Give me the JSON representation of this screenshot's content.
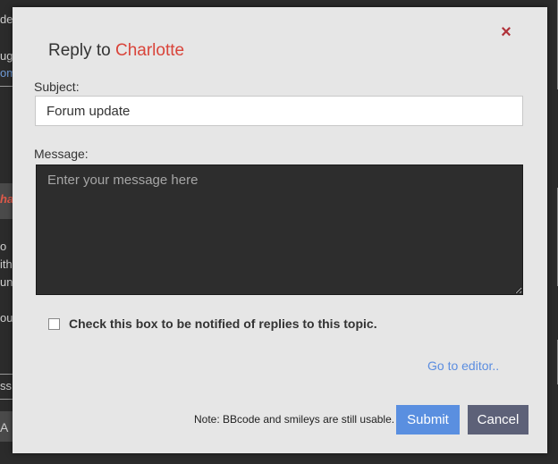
{
  "background_fragments": {
    "f1": "de",
    "f2": "ugg",
    "f3": "om",
    "f4": "ha",
    "f5": "o",
    "f6": "ith",
    "f7": "und",
    "f8": "ou",
    "f9": "ss",
    "f10": "A"
  },
  "modal": {
    "close_icon": "×",
    "title_prefix": "Reply to ",
    "recipient": "Charlotte",
    "subject_label": "Subject:",
    "subject_value": "Forum update",
    "message_label": "Message:",
    "message_placeholder": "Enter your message here",
    "notify_label": "Check this box to be notified of replies to this topic.",
    "notify_checked": false,
    "editor_link": "Go to editor..",
    "note": "Note: BBcode and smileys are still usable.",
    "submit_label": "Submit",
    "cancel_label": "Cancel"
  },
  "colors": {
    "recipient": "#d9443a",
    "link": "#5b8de0",
    "submit_bg": "#5a8fe0",
    "cancel_bg": "#5d6178",
    "close": "#b0323a"
  }
}
